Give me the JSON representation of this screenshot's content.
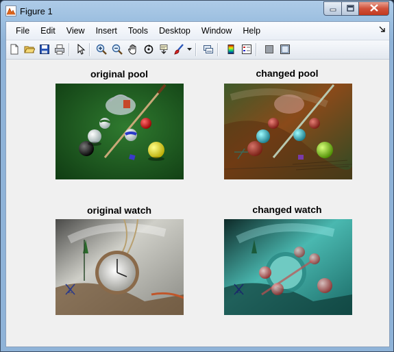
{
  "window": {
    "title": "Figure 1",
    "icons": {
      "app": "matlab-figure-icon",
      "minimize": "minimize-icon",
      "maximize": "maximize-icon",
      "close": "close-icon"
    }
  },
  "menu": {
    "items": [
      "File",
      "Edit",
      "View",
      "Insert",
      "Tools",
      "Desktop",
      "Window",
      "Help"
    ],
    "dock_icon": "dock-arrow-icon"
  },
  "toolbar": {
    "buttons": [
      "new-figure-icon",
      "open-file-icon",
      "save-icon",
      "print-icon",
      "edit-plot-icon",
      "zoom-in-icon",
      "zoom-out-icon",
      "pan-icon",
      "rotate-3d-icon",
      "data-cursor-icon",
      "brush-icon",
      "brush-dropdown-icon",
      "link-plot-icon",
      "insert-colorbar-icon",
      "insert-legend-icon",
      "hide-plot-tools-icon",
      "show-plot-tools-icon"
    ]
  },
  "figure": {
    "panels": [
      {
        "title": "original pool"
      },
      {
        "title": "changed pool"
      },
      {
        "title": "original watch"
      },
      {
        "title": "changed watch"
      }
    ]
  },
  "colors": {
    "pool_felt": "#1f5a1f",
    "changed_pool_bg": "#7a3a1a",
    "watch_paper": "#8a8a84",
    "changed_watch_bg": "#1f6f6a"
  }
}
